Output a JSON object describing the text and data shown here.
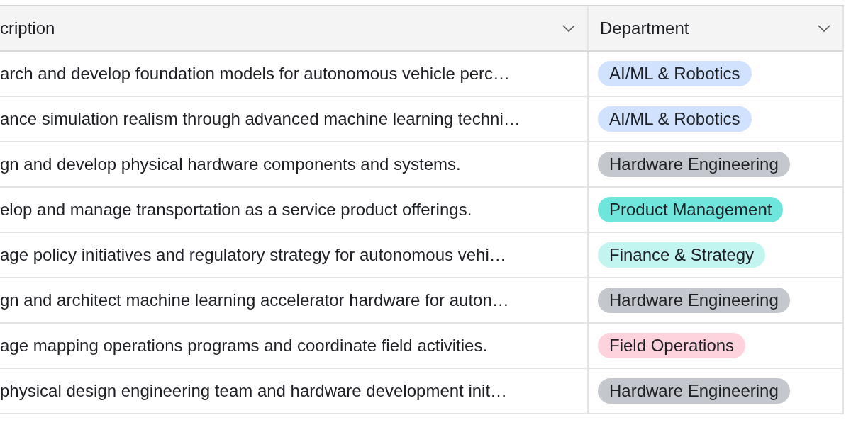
{
  "table": {
    "columns": [
      {
        "label": "cription"
      },
      {
        "label": "Department"
      }
    ],
    "rows": [
      {
        "description": "arch and develop foundation models for autonomous vehicle perc…",
        "department": {
          "label": "AI/ML & Robotics",
          "color": "#d1e2ff"
        }
      },
      {
        "description": "ance simulation realism through advanced machine learning techni…",
        "department": {
          "label": "AI/ML & Robotics",
          "color": "#d1e2ff"
        }
      },
      {
        "description": "gn and develop physical hardware components and systems.",
        "department": {
          "label": "Hardware Engineering",
          "color": "#c4c7cd"
        }
      },
      {
        "description": "elop and manage transportation as a service product offerings.",
        "department": {
          "label": "Product Management",
          "color": "#6fe6dc"
        }
      },
      {
        "description": "age policy initiatives and regulatory strategy for autonomous vehi…",
        "department": {
          "label": "Finance & Strategy",
          "color": "#c3f5f0"
        }
      },
      {
        "description": "gn and architect machine learning accelerator hardware for auton…",
        "department": {
          "label": "Hardware Engineering",
          "color": "#c4c7cd"
        }
      },
      {
        "description": "age mapping operations programs and coordinate field activities.",
        "department": {
          "label": "Field Operations",
          "color": "#ffd3de"
        }
      },
      {
        "description": " physical design engineering team and hardware development init…",
        "department": {
          "label": "Hardware Engineering",
          "color": "#c4c7cd"
        }
      }
    ]
  }
}
